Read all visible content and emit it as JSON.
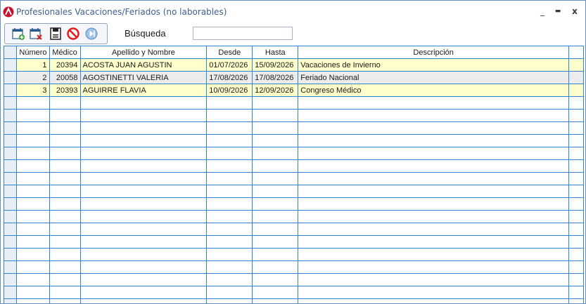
{
  "window": {
    "title": "Profesionales Vacaciones/Feriados (no laborables)",
    "minimize_glyph": "_",
    "maximize_glyph": "▬",
    "close_glyph": "x"
  },
  "toolbar": {
    "buttons": [
      {
        "icon": "add-calendar-icon"
      },
      {
        "icon": "delete-calendar-icon"
      },
      {
        "icon": "save-icon"
      },
      {
        "icon": "cancel-icon"
      },
      {
        "icon": "exit-icon"
      }
    ]
  },
  "search": {
    "label": "Búsqueda",
    "value": ""
  },
  "table": {
    "columns": [
      "Número",
      "Médico",
      "Apellido y Nombre",
      "Desde",
      "Hasta",
      "Descripción"
    ],
    "rows": [
      {
        "numero": "1",
        "medico": "20394",
        "nombre": "ACOSTA JUAN AGUSTIN",
        "desde": "01/07/2026",
        "hasta": "15/09/2026",
        "descripcion": "Vacaciones de Invierno"
      },
      {
        "numero": "2",
        "medico": "20058",
        "nombre": "AGOSTINETTI VALERIA",
        "desde": "17/08/2026",
        "hasta": "17/08/2026",
        "descripcion": "Feriado Nacional"
      },
      {
        "numero": "3",
        "medico": "20393",
        "nombre": "AGUIRRE FLAVIA",
        "desde": "10/09/2026",
        "hasta": "12/09/2026",
        "descripcion": "Congreso Médico"
      }
    ]
  },
  "colors": {
    "accent": "#2f86d1",
    "highlight_row": "#ffffcc",
    "alt_row": "#ececec",
    "title_text": "#3c5f8f"
  }
}
